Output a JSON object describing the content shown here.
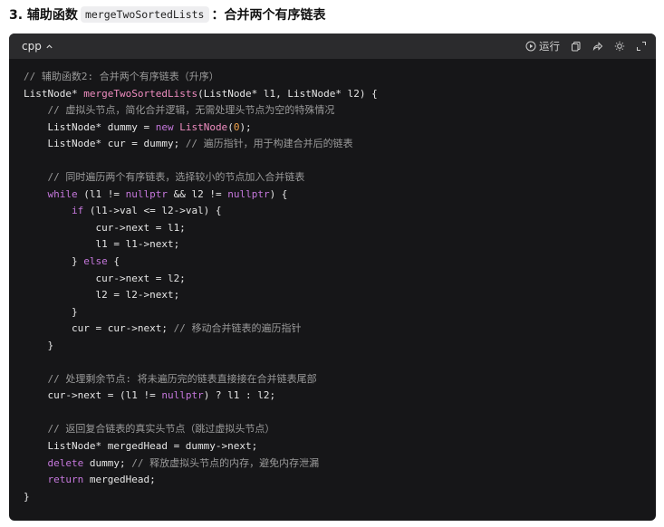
{
  "heading": {
    "prefix": "3. 辅助函数",
    "code": "mergeTwoSortedLists",
    "suffix": "：合并两个有序链表"
  },
  "code_block": {
    "language": "cpp",
    "toolbar": {
      "run_label": "运行",
      "icons": [
        "play-icon",
        "copy-icon",
        "share-icon",
        "theme-icon",
        "expand-icon"
      ]
    },
    "lines": [
      [
        [
          "cm",
          "// 辅助函数2: 合并两个有序链表（升序）"
        ]
      ],
      [
        [
          "df",
          "ListNode* "
        ],
        [
          "fn",
          "mergeTwoSortedLists"
        ],
        [
          "df",
          "(ListNode* l1, ListNode* l2) {"
        ]
      ],
      [
        [
          "df",
          "    "
        ],
        [
          "cm",
          "// 虚拟头节点，简化合并逻辑，无需处理头节点为空的特殊情况"
        ]
      ],
      [
        [
          "df",
          "    ListNode* dummy = "
        ],
        [
          "kw",
          "new"
        ],
        [
          "df",
          " "
        ],
        [
          "fn",
          "ListNode"
        ],
        [
          "df",
          "("
        ],
        [
          "num",
          "0"
        ],
        [
          "df",
          ");"
        ]
      ],
      [
        [
          "df",
          "    ListNode* cur = dummy; "
        ],
        [
          "cm",
          "// 遍历指针，用于构建合并后的链表"
        ]
      ],
      [],
      [
        [
          "df",
          "    "
        ],
        [
          "cm",
          "// 同时遍历两个有序链表，选择较小的节点加入合并链表"
        ]
      ],
      [
        [
          "df",
          "    "
        ],
        [
          "kw",
          "while"
        ],
        [
          "df",
          " (l1 != "
        ],
        [
          "kw",
          "nullptr"
        ],
        [
          "df",
          " && l2 != "
        ],
        [
          "kw",
          "nullptr"
        ],
        [
          "df",
          ") {"
        ]
      ],
      [
        [
          "df",
          "        "
        ],
        [
          "kw",
          "if"
        ],
        [
          "df",
          " (l1->val <= l2->val) {"
        ]
      ],
      [
        [
          "df",
          "            cur->next = l1;"
        ]
      ],
      [
        [
          "df",
          "            l1 = l1->next;"
        ]
      ],
      [
        [
          "df",
          "        } "
        ],
        [
          "kw",
          "else"
        ],
        [
          "df",
          " {"
        ]
      ],
      [
        [
          "df",
          "            cur->next = l2;"
        ]
      ],
      [
        [
          "df",
          "            l2 = l2->next;"
        ]
      ],
      [
        [
          "df",
          "        }"
        ]
      ],
      [
        [
          "df",
          "        cur = cur->next; "
        ],
        [
          "cm",
          "// 移动合并链表的遍历指针"
        ]
      ],
      [
        [
          "df",
          "    }"
        ]
      ],
      [],
      [
        [
          "df",
          "    "
        ],
        [
          "cm",
          "// 处理剩余节点: 将未遍历完的链表直接接在合并链表尾部"
        ]
      ],
      [
        [
          "df",
          "    cur->next = (l1 != "
        ],
        [
          "kw",
          "nullptr"
        ],
        [
          "df",
          ") ? l1 : l2;"
        ]
      ],
      [],
      [
        [
          "df",
          "    "
        ],
        [
          "cm",
          "// 返回复合链表的真实头节点（跳过虚拟头节点）"
        ]
      ],
      [
        [
          "df",
          "    ListNode* mergedHead = dummy->next;"
        ]
      ],
      [
        [
          "df",
          "    "
        ],
        [
          "kw",
          "delete"
        ],
        [
          "df",
          " dummy; "
        ],
        [
          "cm",
          "// 释放虚拟头节点的内存，避免内存泄漏"
        ]
      ],
      [
        [
          "df",
          "    "
        ],
        [
          "kw",
          "return"
        ],
        [
          "df",
          " mergedHead;"
        ]
      ],
      [
        [
          "df",
          "}"
        ]
      ]
    ]
  }
}
